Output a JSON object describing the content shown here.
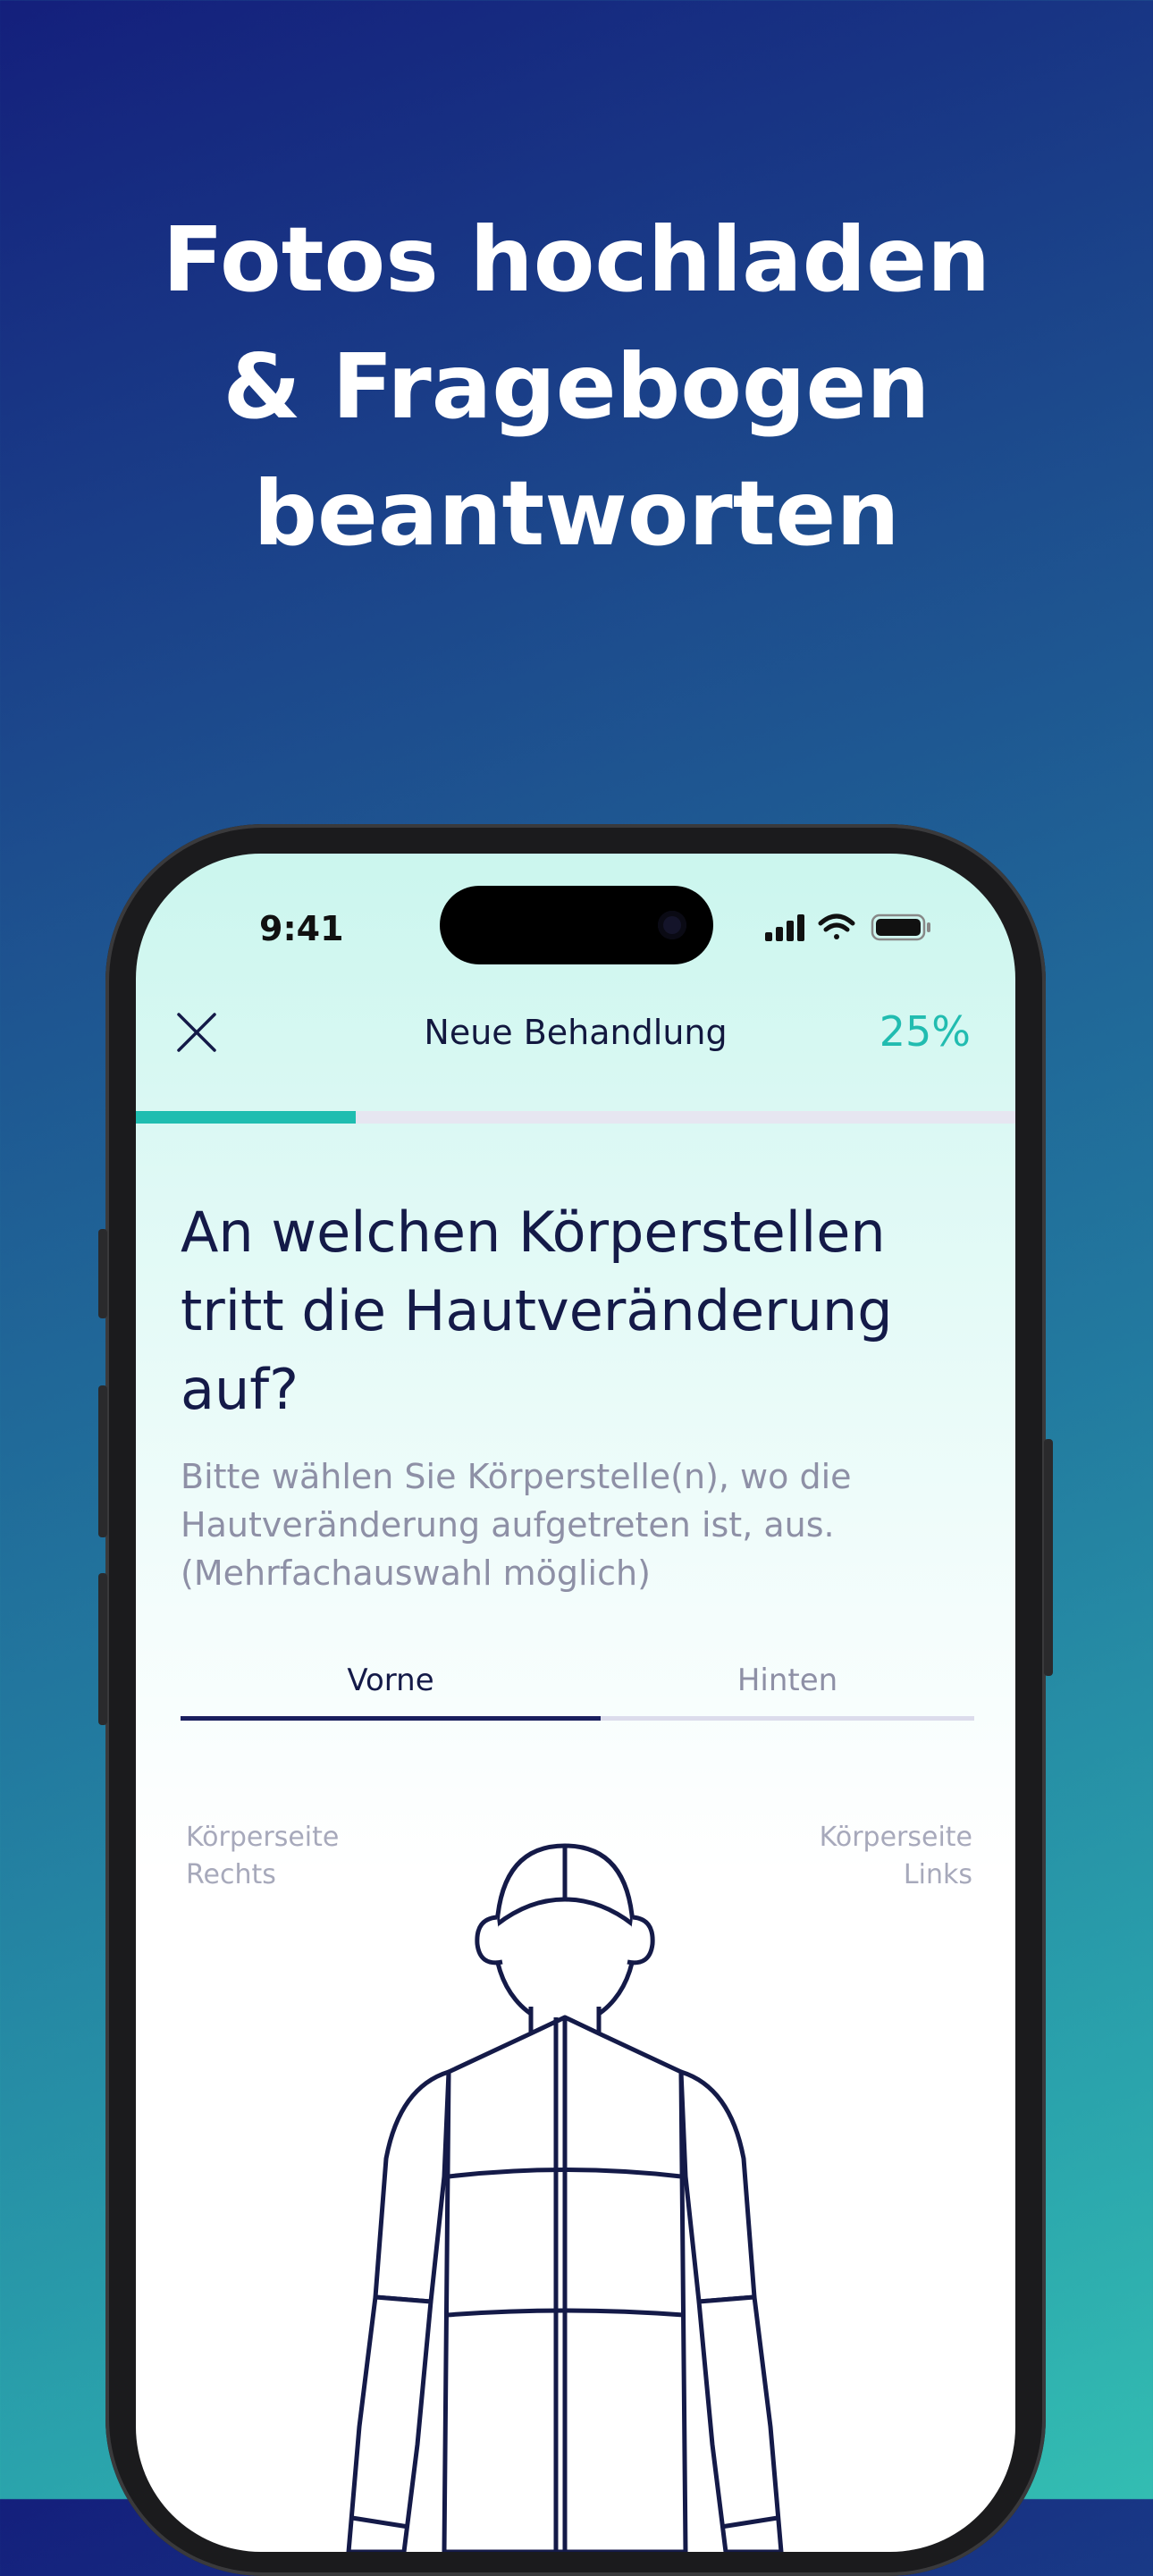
{
  "headline": [
    "Fotos hochladen",
    "& Fragebogen",
    "beantworten"
  ],
  "status_bar": {
    "time": "9:41",
    "icons": [
      "signal-icon",
      "wifi-icon",
      "battery-icon"
    ]
  },
  "nav": {
    "title": "Neue Behandlung",
    "progress_label": "25%",
    "progress": 0.25,
    "close_icon": "close-icon"
  },
  "question": {
    "lines": [
      "An welchen Körperstellen",
      "tritt die Hautveränderung",
      "auf?"
    ]
  },
  "hint": {
    "lines": [
      "Bitte wählen Sie Körperstelle(n), wo die",
      "Hautveränderung aufgetreten ist, aus.",
      "(Mehrfachauswahl möglich)"
    ]
  },
  "tabs": [
    {
      "label": "Vorne",
      "selected": true
    },
    {
      "label": "Hinten",
      "selected": false
    }
  ],
  "body_sides": {
    "right": [
      "Körperseite",
      "Rechts"
    ],
    "left": [
      "Körperseite",
      "Links"
    ]
  },
  "colors": {
    "accent": "#1fbdb0",
    "navy": "#141a48",
    "muted": "#8e90a6"
  }
}
